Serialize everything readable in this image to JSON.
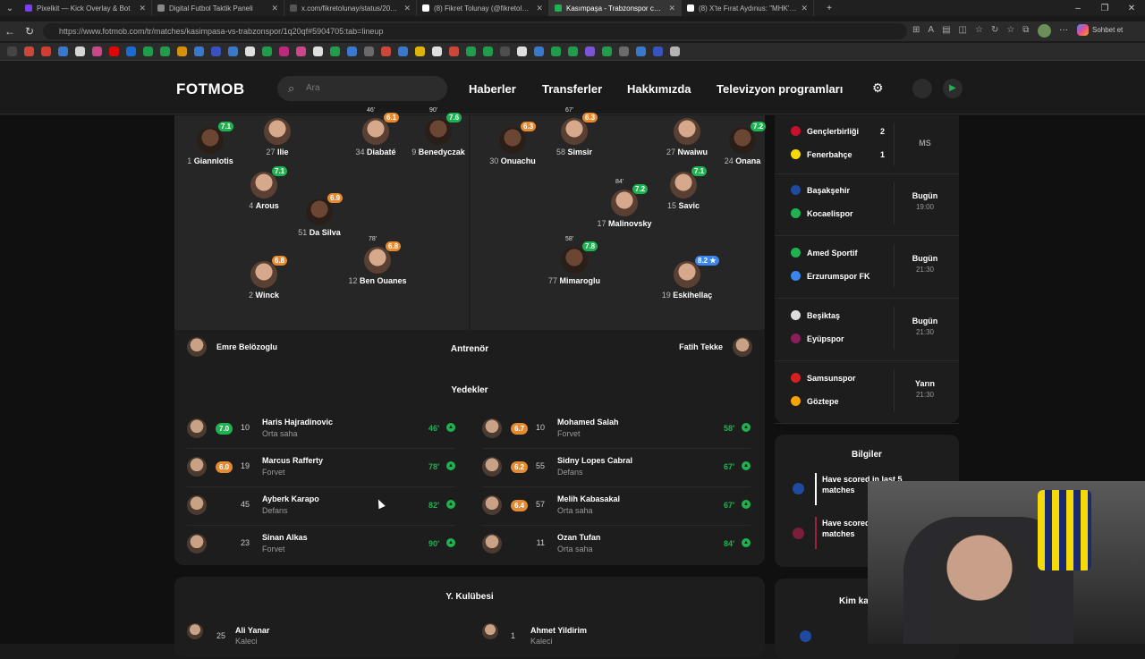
{
  "browser": {
    "tabs": [
      {
        "title": "Pixelkit — Kick Overlay & Bot",
        "color": "#7a3ff0",
        "active": false
      },
      {
        "title": "Digital Futbol Taktik Paneli",
        "color": "#888888",
        "active": false
      },
      {
        "title": "x.com/fikretolunay/status/208894",
        "color": "#555555",
        "active": false
      },
      {
        "title": "(8) Fikret Tolunay (@fikretolunay) /",
        "color": "#ffffff",
        "active": false
      },
      {
        "title": "Kasımpaşa - Trabzonspor canlı skor",
        "color": "#1fb250",
        "active": true
      },
      {
        "title": "(8) X'te Fırat Aydınus: \"MHK'nın ile",
        "color": "#ffffff",
        "active": false
      }
    ],
    "url": "https://www.fotmob.com/tr/matches/kasimpasa-vs-trabzonspor/1q20qf#5904705:tab=lineup",
    "profile_label": "Sohbet et"
  },
  "header": {
    "logo": "FOTMOB",
    "search_placeholder": "Ara",
    "menu": [
      "Haberler",
      "Transferler",
      "Hakkımızda",
      "Televizyon programları"
    ]
  },
  "pitch": {
    "home_players": [
      {
        "name": "Giannlotis",
        "num": "1",
        "rating": "7.1",
        "rc": "g"
      },
      {
        "name": "Ilie",
        "num": "27",
        "rating": "",
        "rc": ""
      },
      {
        "name": "Arous",
        "num": "4",
        "rating": "7.1",
        "rc": "g"
      },
      {
        "name": "Da Silva",
        "num": "51",
        "rating": "6.9",
        "rc": "o"
      },
      {
        "name": "Winck",
        "num": "2",
        "rating": "6.8",
        "rc": "o"
      },
      {
        "name": "Diabaté",
        "num": "34",
        "rating": "6.1",
        "rc": "o",
        "sub": "46'"
      },
      {
        "name": "Benedyczak",
        "num": "9",
        "rating": "7.6",
        "rc": "g",
        "sub": "90'"
      },
      {
        "name": "Ben Ouanes",
        "num": "12",
        "rating": "6.8",
        "rc": "o",
        "sub": "78'"
      }
    ],
    "away_players": [
      {
        "name": "Onuachu",
        "num": "30",
        "rating": "6.3",
        "rc": "o"
      },
      {
        "name": "Simsir",
        "num": "58",
        "rating": "6.3",
        "rc": "o",
        "sub": "67'"
      },
      {
        "name": "Nwaiwu",
        "num": "27",
        "rating": "",
        "rc": ""
      },
      {
        "name": "Onana",
        "num": "24",
        "rating": "7.2",
        "rc": "g"
      },
      {
        "name": "Savic",
        "num": "15",
        "rating": "7.1",
        "rc": "g"
      },
      {
        "name": "Malinovsky",
        "num": "17",
        "rating": "7.2",
        "rc": "g",
        "sub": "84'"
      },
      {
        "name": "Mimaroglu",
        "num": "77",
        "rating": "7.8",
        "rc": "g",
        "sub": "58'"
      },
      {
        "name": "Eskihellaç",
        "num": "19",
        "rating": "8.2 ★",
        "rc": "b"
      }
    ]
  },
  "coaches": {
    "label": "Antrenör",
    "home": "Emre Belözoglu",
    "away": "Fatih Tekke"
  },
  "subs": {
    "label": "Yedekler",
    "home": [
      {
        "rating": "7.0",
        "rc": "g",
        "num": "10",
        "name": "Haris Hajradinovic",
        "pos": "Orta saha",
        "min": "46'"
      },
      {
        "rating": "6.0",
        "rc": "o",
        "num": "19",
        "name": "Marcus Rafferty",
        "pos": "Forvet",
        "min": "78'"
      },
      {
        "rating": "",
        "rc": "",
        "num": "45",
        "name": "Ayberk Karapo",
        "pos": "Defans",
        "min": "82'"
      },
      {
        "rating": "",
        "rc": "",
        "num": "23",
        "name": "Sinan Alkas",
        "pos": "Forvet",
        "min": "90'"
      }
    ],
    "away": [
      {
        "rating": "6.7",
        "rc": "o",
        "num": "10",
        "name": "Mohamed Salah",
        "pos": "Forvet",
        "min": "58'"
      },
      {
        "rating": "6.2",
        "rc": "o",
        "num": "55",
        "name": "Sidny Lopes Cabral",
        "pos": "Defans",
        "min": "67'"
      },
      {
        "rating": "6.4",
        "rc": "o",
        "num": "57",
        "name": "Melih Kabasakal",
        "pos": "Orta saha",
        "min": "67'"
      },
      {
        "rating": "",
        "rc": "",
        "num": "11",
        "name": "Ozan Tufan",
        "pos": "Orta saha",
        "min": "84'"
      }
    ]
  },
  "bench_section": {
    "label": "Y. Kulübesi",
    "home": {
      "num": "25",
      "name": "Ali Yanar",
      "pos": "Kaleci"
    },
    "away": {
      "num": "1",
      "name": "Ahmet Yildirim",
      "pos": "Kaleci"
    }
  },
  "sidebar": {
    "matches": [
      {
        "home": "Gençlerbirliği",
        "away": "Fenerbahçe",
        "hs": "2",
        "as": "1",
        "status": "MS",
        "time": "",
        "hc": "#c8102e",
        "ac": "#f5d90a"
      },
      {
        "home": "Başakşehir",
        "away": "Kocaelispor",
        "hs": "",
        "as": "",
        "status": "Bugün",
        "time": "19:00",
        "hc": "#1f4aa0",
        "ac": "#1fb250"
      },
      {
        "home": "Amed Sportif",
        "away": "Erzurumspor FK",
        "hs": "",
        "as": "",
        "status": "Bugün",
        "time": "21:30",
        "hc": "#1fb250",
        "ac": "#3b86ea"
      },
      {
        "home": "Beşiktaş",
        "away": "Eyüpspor",
        "hs": "",
        "as": "",
        "status": "Bugün",
        "time": "21:30",
        "hc": "#dddddd",
        "ac": "#8a1f5a"
      },
      {
        "home": "Samsunspor",
        "away": "Göztepe",
        "hs": "",
        "as": "",
        "status": "Yarın",
        "time": "21:30",
        "hc": "#d62020",
        "ac": "#f5a300"
      }
    ],
    "info_title": "Bilgiler",
    "info_items": [
      "Have scored in last 5 matches",
      "Have scored in last 5 matches"
    ],
    "next_title": "Kim ka"
  }
}
